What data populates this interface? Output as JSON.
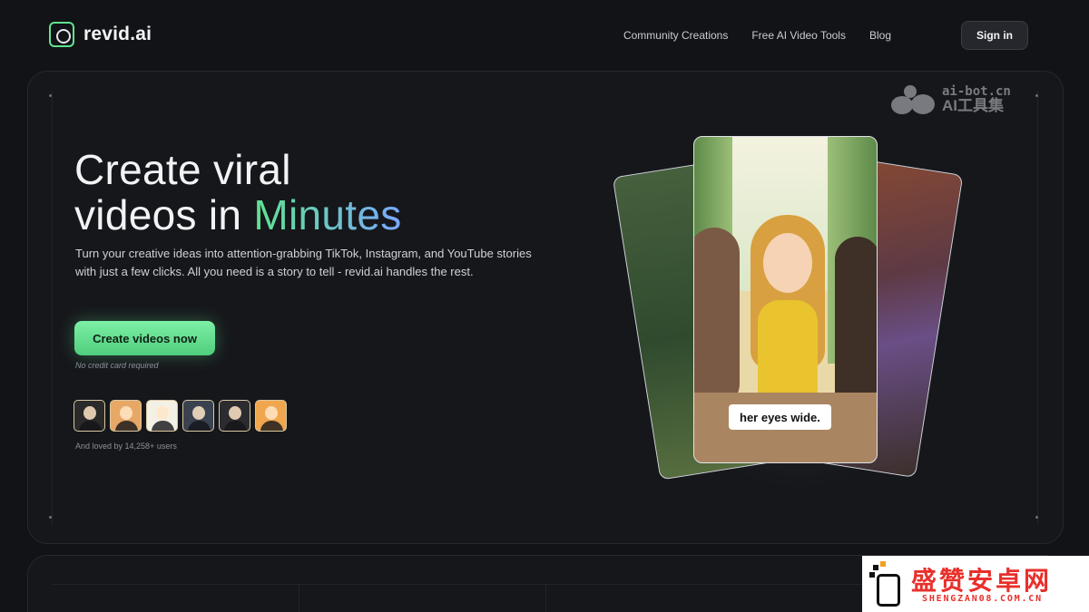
{
  "brand": {
    "name_main": "revid",
    "name_suffix": ".ai"
  },
  "nav": {
    "links": [
      "Community Creations",
      "Free AI Video Tools",
      "Blog"
    ],
    "signin": "Sign in"
  },
  "hero": {
    "headline_line1": "Create viral",
    "headline_line2_plain": "videos in ",
    "headline_line2_accent": "Minutes",
    "subtitle": "Turn your creative ideas into attention-grabbing TikTok, Instagram, and YouTube stories with just a few clicks. All you need is a story to tell - revid.ai handles the rest.",
    "cta": "Create videos now",
    "cta_note": "No credit card required",
    "users_note": "And loved by 14,258+ users",
    "avatar_colors": [
      "#2a2a2a",
      "#e7a866",
      "#f3f1e6",
      "#3a4250",
      "#2b2b30",
      "#f0a64f"
    ]
  },
  "preview": {
    "caption": "her eyes wide."
  },
  "watermarks": {
    "top_right_line1": "ai-bot.cn",
    "top_right_line2": "AI工具集",
    "bottom_right_title": "盛赞安卓网",
    "bottom_right_url": "SHENGZAN08.COM.CN"
  },
  "colors": {
    "accent_green": "#5fe38e",
    "accent_blue": "#7aa8ff",
    "background": "#121316"
  }
}
